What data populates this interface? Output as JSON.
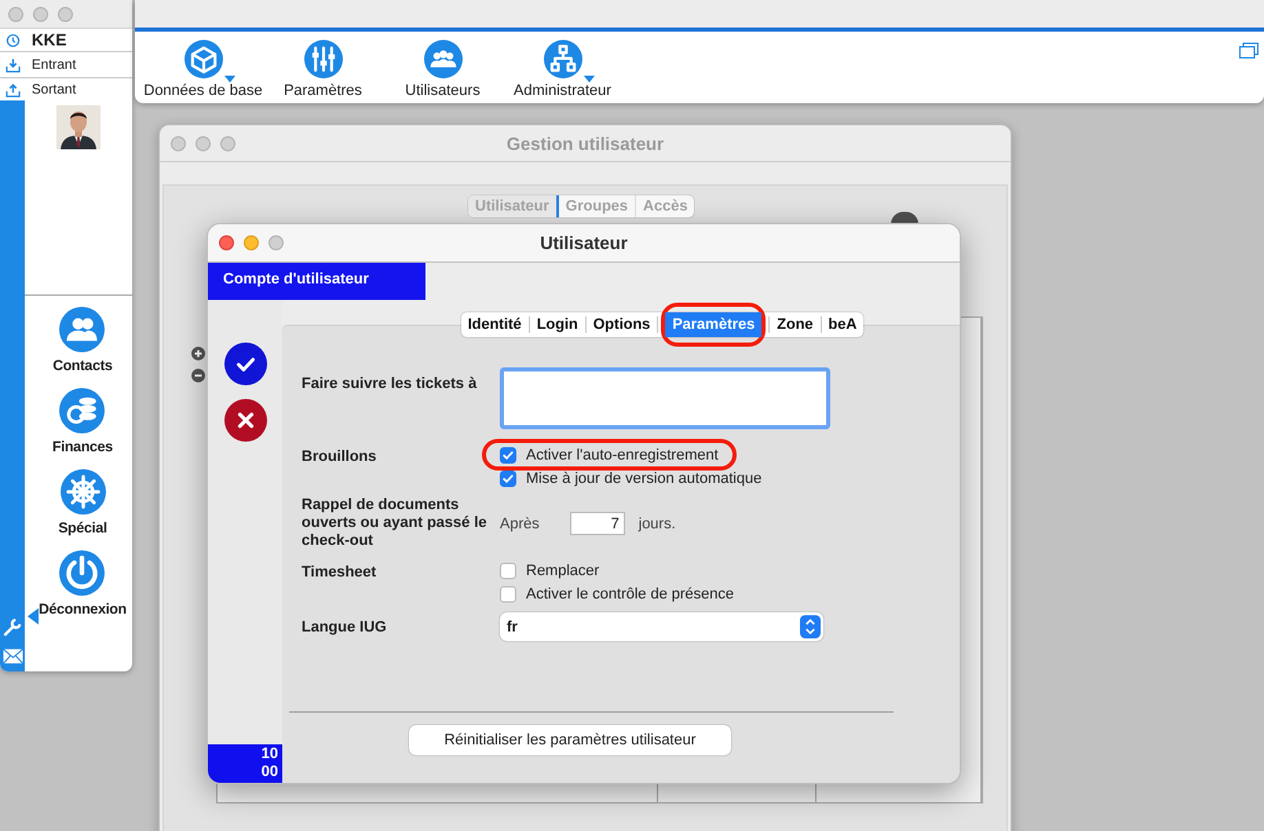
{
  "sidebar": {
    "user": "KKE",
    "mail": [
      {
        "label": "Entrant"
      },
      {
        "label": "Sortant"
      }
    ],
    "nav": [
      {
        "label": "Contacts"
      },
      {
        "label": "Finances"
      },
      {
        "label": "Spécial"
      },
      {
        "label": "Déconnexion"
      }
    ]
  },
  "toolbar": {
    "items": [
      {
        "label": "Données de base",
        "dropdown": true
      },
      {
        "label": "Paramètres",
        "dropdown": false
      },
      {
        "label": "Utilisateurs",
        "dropdown": false
      },
      {
        "label": "Administrateur",
        "dropdown": true
      }
    ]
  },
  "manager": {
    "title": "Gestion utilisateur",
    "tabs": [
      {
        "label": "Utilisateur",
        "selected": true
      },
      {
        "label": "Groupes",
        "selected": false
      },
      {
        "label": "Accès",
        "selected": false
      }
    ]
  },
  "dialog": {
    "title": "Utilisateur",
    "section": "Compte d'utilisateur",
    "tabs": [
      {
        "label": "Identité",
        "selected": false,
        "highlighted": false
      },
      {
        "label": "Login",
        "selected": false,
        "highlighted": false
      },
      {
        "label": "Options",
        "selected": false,
        "highlighted": false
      },
      {
        "label": "Paramètres",
        "selected": true,
        "highlighted": true
      },
      {
        "label": "Zone",
        "selected": false,
        "highlighted": false
      },
      {
        "label": "beA",
        "selected": false,
        "highlighted": false
      }
    ],
    "rows": [
      {
        "kind": "textarea",
        "label": "Faire suivre les tickets à"
      },
      {
        "kind": "checks",
        "label": "Brouillons",
        "options": [
          {
            "label": "Activer l'auto-enregistrement",
            "checked": true,
            "highlighted": true
          },
          {
            "label": "Mise à jour de version automatique",
            "checked": true,
            "highlighted": false
          }
        ]
      },
      {
        "kind": "number",
        "label": "Rappel de documents ouverts ou ayant passé le check-out",
        "prefix": "Après",
        "value": "7",
        "suffix": "jours."
      },
      {
        "kind": "checks",
        "label": "Timesheet",
        "options": [
          {
            "label": "Remplacer",
            "checked": false,
            "highlighted": false
          },
          {
            "label": "Activer le contrôle de présence",
            "checked": false,
            "highlighted": false
          }
        ]
      },
      {
        "kind": "select",
        "label": "Langue IUG",
        "value": "fr"
      }
    ],
    "counter": [
      "10",
      "00"
    ],
    "reset_button": "Réinitialiser les paramètres utilisateur"
  }
}
